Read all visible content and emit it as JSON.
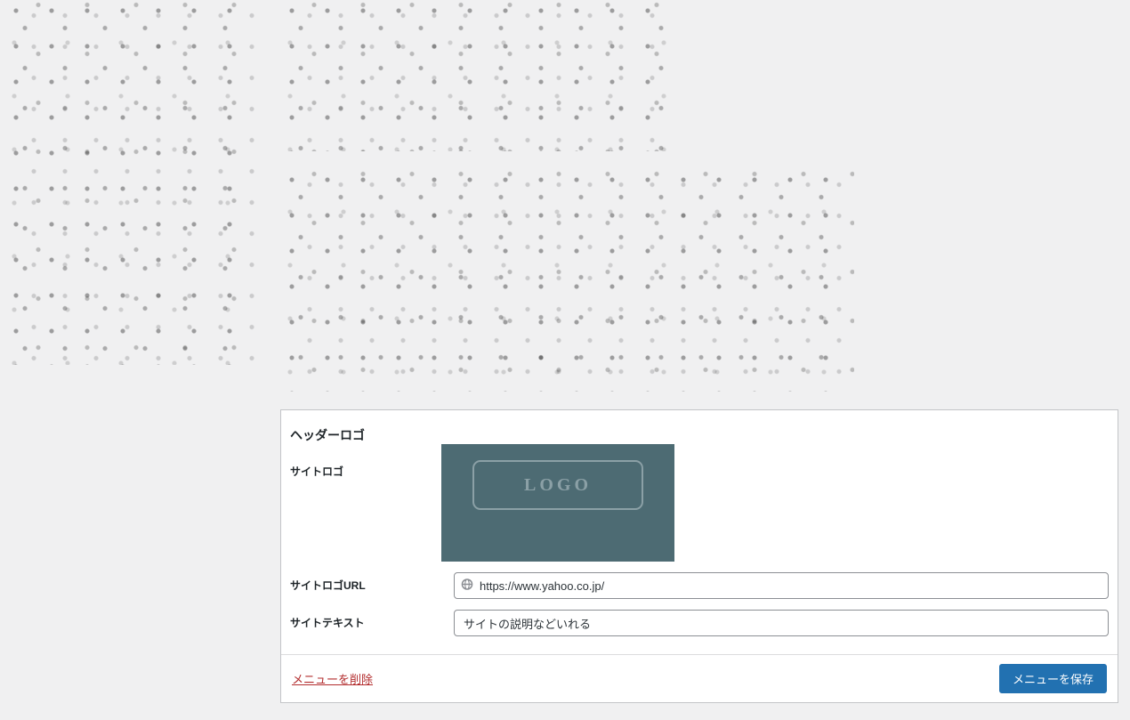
{
  "header_logo": {
    "section_title": "ヘッダーロゴ",
    "site_logo_label": "サイトロゴ",
    "logo_placeholder_text": "LOGO",
    "site_logo_url_label": "サイトロゴURL",
    "site_logo_url_value": "https://www.yahoo.co.jp/",
    "site_text_label": "サイトテキスト",
    "site_text_value": "サイトの説明などいれる"
  },
  "footer": {
    "delete_label": "メニューを削除",
    "save_label": "メニューを保存"
  }
}
